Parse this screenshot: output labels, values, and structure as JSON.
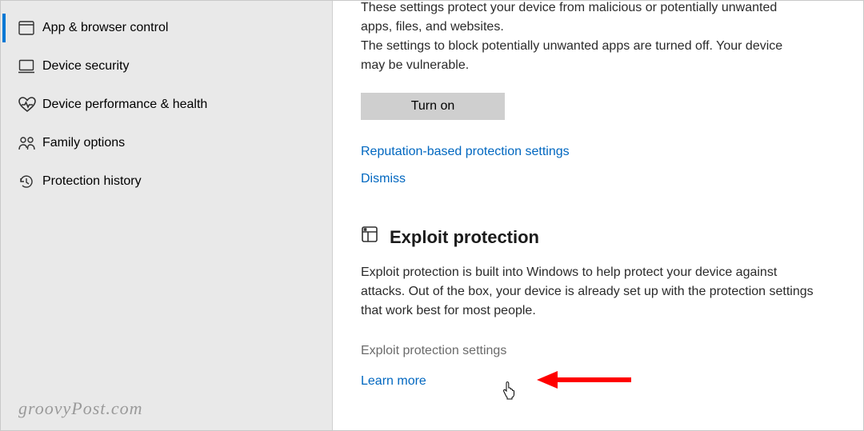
{
  "sidebar": {
    "items": [
      {
        "label": "App & browser control",
        "active": true,
        "icon": "browser-icon"
      },
      {
        "label": "Device security",
        "active": false,
        "icon": "device-icon"
      },
      {
        "label": "Device performance & health",
        "active": false,
        "icon": "health-icon"
      },
      {
        "label": "Family options",
        "active": false,
        "icon": "family-icon"
      },
      {
        "label": "Protection history",
        "active": false,
        "icon": "history-icon"
      }
    ]
  },
  "main": {
    "reputation": {
      "line1": "These settings protect your device from malicious or potentially unwanted apps, files, and websites.",
      "line2": "The settings to block potentially unwanted apps are turned off. Your device may be vulnerable.",
      "button": "Turn on",
      "settings_link": "Reputation-based protection settings",
      "dismiss_link": "Dismiss"
    },
    "exploit": {
      "title": "Exploit protection",
      "body": "Exploit protection is built into Windows to help protect your device against attacks.  Out of the box, your device is already set up with the protection settings that work best for most people.",
      "settings_link": "Exploit protection settings",
      "learn_link": "Learn more"
    }
  },
  "watermark": "groovyPost.com",
  "colors": {
    "accent": "#0078d4",
    "link": "#0067c0"
  }
}
